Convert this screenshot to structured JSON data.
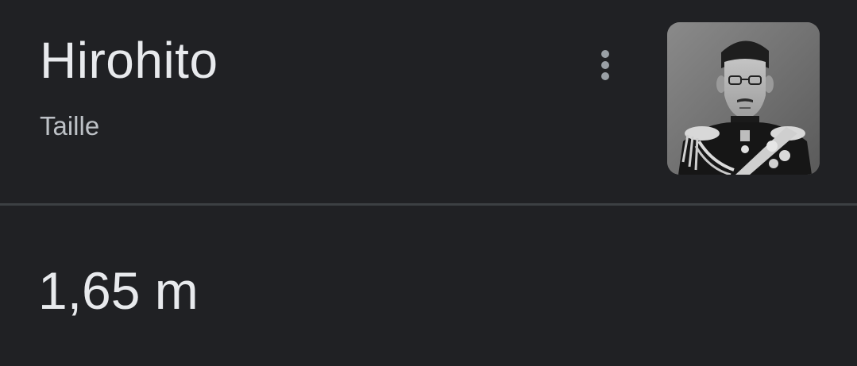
{
  "header": {
    "title": "Hirohito",
    "subtitle": "Taille",
    "menu_icon": "more-vert-icon",
    "thumbnail_icon": "portrait-photo"
  },
  "result": {
    "value": "1,65 m"
  },
  "colors": {
    "background": "#202124",
    "text_primary": "#e8eaed",
    "text_secondary": "#bdc1c6",
    "divider": "#3c4043",
    "icon": "#9aa0a6"
  }
}
